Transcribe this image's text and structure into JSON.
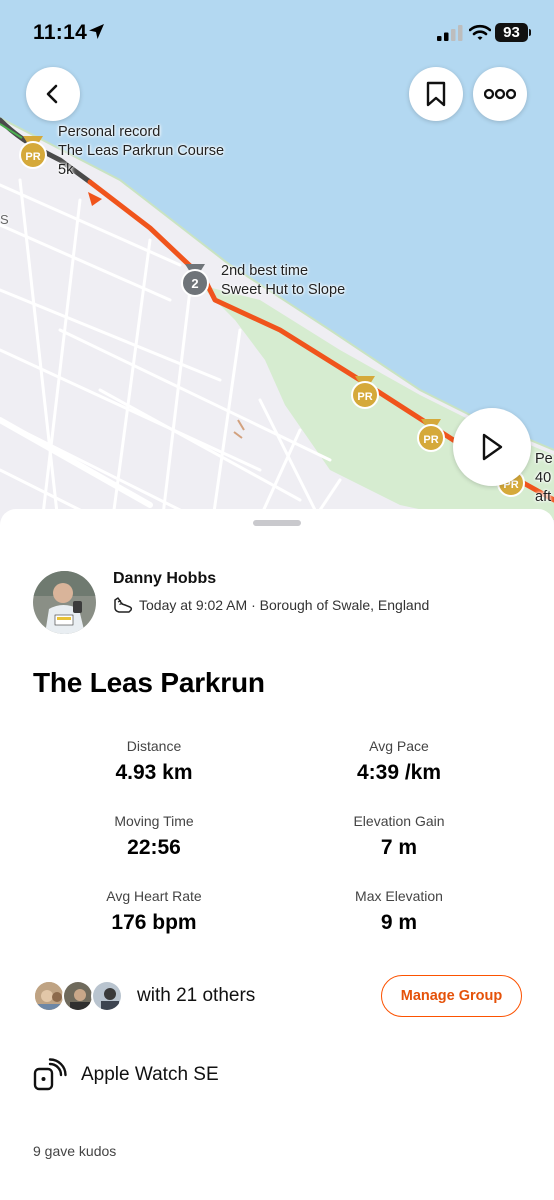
{
  "status_bar": {
    "time": "11:14",
    "battery": "93",
    "location_icon": "location-arrow-icon",
    "signal_icon": "cellular-signal-icon",
    "wifi_icon": "wifi-icon"
  },
  "map": {
    "colors": {
      "water": "#b3d8f1",
      "land": "#efeef3",
      "park": "#d6ecd0",
      "route": "#f0541c",
      "medal_gold": "#d5a93a"
    },
    "edge_text": "S",
    "labels": [
      {
        "lines": [
          "Personal record",
          "The Leas Parkrun Course",
          "5k"
        ]
      },
      {
        "lines": [
          "2nd best time",
          "Sweet Hut to Slope"
        ]
      },
      {
        "lines": [
          "Pe",
          "40",
          "aft"
        ]
      }
    ],
    "medals": [
      {
        "text": "PR",
        "icon": "pr-medal-icon"
      },
      {
        "text": "2",
        "icon": "second-place-medal-icon"
      },
      {
        "text": "PR",
        "icon": "pr-medal-icon"
      },
      {
        "text": "PR",
        "icon": "pr-medal-icon"
      },
      {
        "text": "PR",
        "icon": "pr-medal-icon"
      }
    ],
    "buttons": {
      "back_icon": "chevron-left-icon",
      "bookmark_icon": "bookmark-icon",
      "more_icon": "more-dots-icon",
      "play_icon": "play-icon"
    }
  },
  "activity": {
    "athlete_name": "Danny Hobbs",
    "activity_icon": "running-shoe-icon",
    "meta": "Today at 9:02 AM · Borough of Swale, England",
    "title": "The Leas Parkrun",
    "stats": [
      {
        "label": "Distance",
        "value": "4.93 km"
      },
      {
        "label": "Avg Pace",
        "value": "4:39 /km"
      },
      {
        "label": "Moving Time",
        "value": "22:56"
      },
      {
        "label": "Elevation Gain",
        "value": "7 m"
      },
      {
        "label": "Avg Heart Rate",
        "value": "176 bpm"
      },
      {
        "label": "Max Elevation",
        "value": "9 m"
      }
    ],
    "group_text": "with 21 others",
    "manage_group_label": "Manage Group",
    "device_icon": "watch-connected-icon",
    "device": "Apple Watch SE",
    "kudos": "9 gave kudos"
  }
}
